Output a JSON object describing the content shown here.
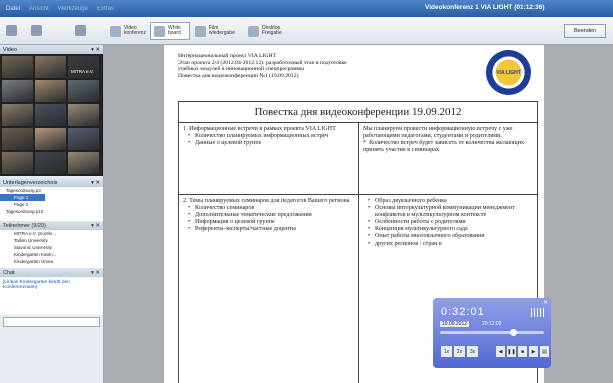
{
  "menu": {
    "items": [
      "Datei",
      "Ansicht",
      "Werkzeuge",
      "Extras"
    ],
    "window_title": "Videokonferenz 1 VIA LIGHT (01:12:36)"
  },
  "toolbar": {
    "video_btn": "Video konferenz",
    "whiteboard_btn": "White board",
    "film_btn": "Film wiedergabe",
    "desktop_btn": "Desktop Freigabe",
    "end_btn": "Beenden"
  },
  "video_panel": {
    "title": "Video",
    "tile_label": "MITRA e.V.",
    "tile_colors": [
      "#6f6a55",
      "#8b7762",
      "#3c3c40",
      "#7a7f86",
      "#a28c6e",
      "#5d6b74",
      "#8f7f6b",
      "#4a5361",
      "#9b8c79",
      "#6b5e52",
      "#b79a7c",
      "#566070",
      "#7f705f",
      "#3f4750",
      "#9a8a76"
    ]
  },
  "agenda_panel": {
    "title": "Unterlagenverzeichnis",
    "items": [
      "Tagesordnung.p3",
      "Page 1",
      "Page 2",
      "Tagesordnung.p10"
    ]
  },
  "participants_panel": {
    "title": "Teilnehmer (9/20)",
    "items": [
      "MITRA e.V. (Konfer...",
      "Tallinn University",
      "Slavonic University",
      "Kindergarten Katrin...",
      "Kindergarten Umea"
    ]
  },
  "chat_panel": {
    "title": "Chat",
    "message": "[Linkari Kindergarten betritt den Konferenzraum]"
  },
  "document": {
    "header": [
      "Интернациональный проект VIA LIGHT",
      "Этап проекта 2/4 (2012.04-2012.12): разработочный этап в подготовке",
      "учебных модулей в инновационной спецпрограммы",
      "Повестка дня видеоконференции №1 (19.09.2012)"
    ],
    "logo_text": "VIA LIGHT",
    "agenda_title": "Повестка дня видеоконференции 19.09.2012",
    "row1_left_title": "1.  Информационные встречи в рамках проекта VIA LIGHT",
    "row1_left_items": [
      "Количество планируемых информационных встреч",
      "Данные о целевой группе"
    ],
    "row1_right": "Мы планируем провести информационную встречу с уже работающими педагогами, студентами и родителями.",
    "row1_right_bullet": "Количество встреч будет зависеть от количества желающих принять участие в семинарах.",
    "row2_left_title": "2.  Темы планируемых семинаров для педагогов Вашего региона",
    "row2_left_items": [
      "Количество семинаров",
      "Дополнительные тематические предложения",
      "Информация о целевой группе",
      "Референты-эксперты/частные доценты"
    ],
    "row2_right_items": [
      "Образ двуязычного ребенка",
      "Основы интеркультурной коммуникации менеджмент конфликтов в мультикультурном контексте",
      "Особенности работы с родителями",
      "Концепция мультикультурного сада",
      "Опыт работы многоязычного образования",
      "других регионов / стран в"
    ]
  },
  "player": {
    "time": "0:32:01",
    "date": "19.09.2012",
    "clock": "20:12:09",
    "speed_1x": "1x",
    "speed_2x": "2x",
    "speed_3x": "3x"
  }
}
